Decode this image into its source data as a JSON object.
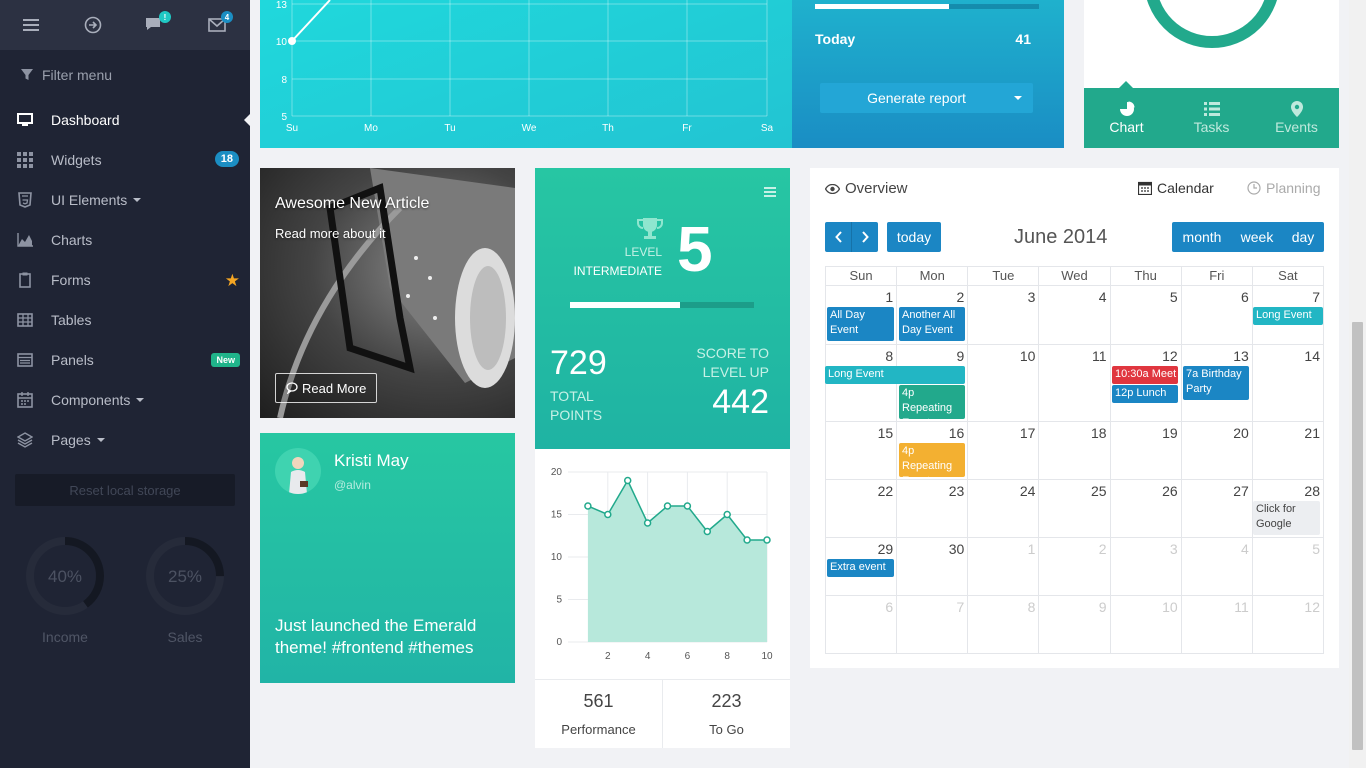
{
  "topbar": {
    "chat_badge": "!",
    "mail_badge": "4"
  },
  "sidebar": {
    "filter_label": "Filter menu",
    "items": [
      {
        "label": "Dashboard",
        "icon": "monitor-icon"
      },
      {
        "label": "Widgets",
        "icon": "grid-icon",
        "badge": "18"
      },
      {
        "label": "UI Elements",
        "icon": "html5-icon"
      },
      {
        "label": "Charts",
        "icon": "area-chart-icon"
      },
      {
        "label": "Forms",
        "icon": "clipboard-icon"
      },
      {
        "label": "Tables",
        "icon": "table-icon"
      },
      {
        "label": "Panels",
        "icon": "panel-icon",
        "tag": "New"
      },
      {
        "label": "Components",
        "icon": "calendar-icon"
      },
      {
        "label": "Pages",
        "icon": "layers-icon"
      }
    ],
    "reset_label": "Reset local storage",
    "donuts": [
      {
        "value": "40%",
        "label": "Income",
        "fraction": 0.4
      },
      {
        "value": "25%",
        "label": "Sales",
        "fraction": 0.25
      }
    ]
  },
  "line_chart": {
    "y_ticks": [
      "13",
      "10",
      "8",
      "5"
    ],
    "x_ticks": [
      "Su",
      "Mo",
      "Tu",
      "We",
      "Th",
      "Fr",
      "Sa"
    ]
  },
  "report": {
    "today_label": "Today",
    "today_value": "41",
    "button": "Generate report"
  },
  "tabs": [
    {
      "label": "Chart",
      "icon": "pie-chart-icon"
    },
    {
      "label": "Tasks",
      "icon": "list-icon"
    },
    {
      "label": "Events",
      "icon": "map-pin-icon"
    }
  ],
  "article": {
    "title": "Awesome New Article",
    "subtitle": "Read more about it",
    "button": "Read More"
  },
  "profile": {
    "name": "Kristi May",
    "handle": "@alvin",
    "post": "Just launched the Emerald theme! #frontend #themes"
  },
  "level": {
    "level_label": "LEVEL",
    "level_name": "INTERMEDIATE",
    "level_value": "5",
    "progress": 0.6,
    "points_value": "729",
    "points_label_1": "TOTAL",
    "points_label_2": "POINTS",
    "score_label_1": "SCORE TO",
    "score_label_2": "LEVEL UP",
    "score_value": "442"
  },
  "stats": {
    "performance_value": "561",
    "performance_label": "Performance",
    "togo_value": "223",
    "togo_label": "To Go"
  },
  "chart_data": {
    "type": "area",
    "x": [
      1,
      2,
      3,
      4,
      5,
      6,
      7,
      8,
      9,
      10
    ],
    "values": [
      16,
      15,
      19,
      14,
      16,
      16,
      13,
      15,
      12,
      12
    ],
    "xticks": [
      "2",
      "4",
      "6",
      "8",
      "10"
    ],
    "yticks": [
      "20",
      "15",
      "10",
      "5",
      "0"
    ],
    "ylim": [
      0,
      20
    ],
    "xlim": [
      0,
      10
    ]
  },
  "calendar": {
    "overview_label": "Overview",
    "calendar_label": "Calendar",
    "planning_label": "Planning",
    "today_btn": "today",
    "title": "June 2014",
    "views": [
      "month",
      "week",
      "day"
    ],
    "weekdays": [
      "Sun",
      "Mon",
      "Tue",
      "Wed",
      "Thu",
      "Fri",
      "Sat"
    ],
    "weeks": [
      [
        "1",
        "2",
        "3",
        "4",
        "5",
        "6",
        "7"
      ],
      [
        "8",
        "9",
        "10",
        "11",
        "12",
        "13",
        "14"
      ],
      [
        "15",
        "16",
        "17",
        "18",
        "19",
        "20",
        "21"
      ],
      [
        "22",
        "23",
        "24",
        "25",
        "26",
        "27",
        "28"
      ],
      [
        "29",
        "30",
        "1",
        "2",
        "3",
        "4",
        "5"
      ],
      [
        "6",
        "7",
        "8",
        "9",
        "10",
        "11",
        "12"
      ]
    ],
    "events": {
      "all_day": "All Day Event",
      "another_all_day": "Another All Day Event",
      "long_event_1": "Long Event",
      "long_event_2": "Long Event",
      "repeating_1": "4p Repeating Event",
      "meeting": "10:30a Meet",
      "lunch": "12p Lunch",
      "birthday": "7a Birthday Party",
      "repeating_2": "4p Repeating Event",
      "google": "Click for Google",
      "extra": "Extra event"
    }
  }
}
